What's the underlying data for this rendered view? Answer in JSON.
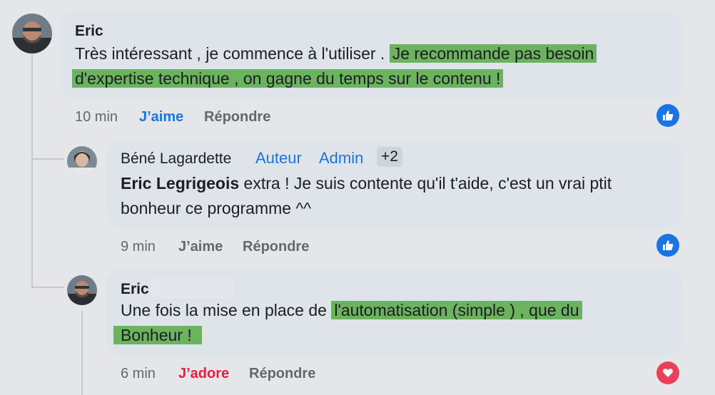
{
  "comments": [
    {
      "author": "Eric",
      "text_plain": "Très intéressant , je commence à l'utiliser . ",
      "text_hl_line1": "Je recommande pas besoin",
      "text_hl_line2": "d'expertise technique , on gagne du temps sur le contenu !",
      "time": "10 min",
      "like_label": "J’aime",
      "reply_label": "Répondre",
      "reaction": "like-icon"
    },
    {
      "author": "Béné Lagardette",
      "badges": [
        "Auteur",
        "Admin"
      ],
      "badge_more": "+2",
      "mention": "Eric Legrigeois",
      "text_line1": " extra ! Je suis contente qu'il t'aide, c'est un vrai ptit",
      "text_line2": "bonheur ce programme ^^",
      "time": "9 min",
      "like_label": "J’aime",
      "reply_label": "Répondre",
      "reaction": "like-icon"
    },
    {
      "author": "Eric",
      "text_plain": "Une fois la mise en place de ",
      "text_hl_line1": "l'automatisation (simple ) , que du",
      "text_hl_line2": "Bonheur !",
      "time": "6 min",
      "love_label": "J’adore",
      "reply_label": "Répondre",
      "reaction": "love-icon"
    }
  ],
  "colors": {
    "background": "#e4e6e9",
    "bubble": "#dfe3ea",
    "highlight": "#6cb35f",
    "like_blue": "#1b74e4",
    "love_red": "#e41e3f"
  }
}
